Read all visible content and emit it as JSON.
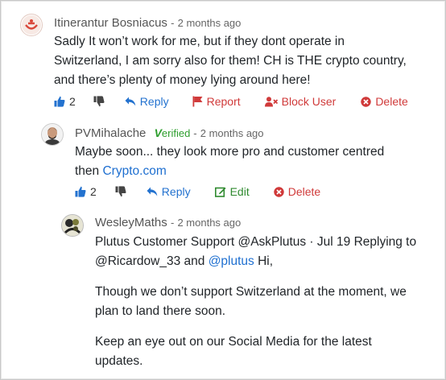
{
  "comments": [
    {
      "author": "Itinerantur Bosniacus",
      "separator": "-",
      "time": "2 months ago",
      "body": [
        "Sadly It won’t work for me, but if they dont operate in",
        "Switzerland, I am sorry also for them! CH is THE crypto country,",
        "and there’s plenty of money lying around here!"
      ],
      "likes": "2",
      "actions": {
        "reply": "Reply",
        "report": "Report",
        "block": "Block User",
        "delete": "Delete"
      }
    },
    {
      "author": "PVMihalache",
      "badge_prefix": "V",
      "badge_rest": "erified",
      "separator": "-",
      "time": "2 months ago",
      "body_line1": "Maybe soon... they look more pro and customer centred",
      "body_line2_prefix": "then ",
      "body_link": "Crypto.com",
      "likes": "2",
      "actions": {
        "reply": "Reply",
        "edit": "Edit",
        "delete": "Delete"
      }
    },
    {
      "author": "WesleyMaths",
      "separator": "-",
      "time": "2 months ago",
      "line1": "Plutus Customer Support @AskPlutus · Jul 19 Replying to",
      "line2_prefix": "@Ricardow_33 and ",
      "line2_link": "@plutus",
      "line2_suffix": " Hi,",
      "para2": [
        "Though we don’t support Switzerland at the moment, we",
        "plan to land there soon."
      ],
      "para3": [
        "Keep an eye out on our Social Media for the latest",
        "updates."
      ]
    }
  ],
  "colors": {
    "link": "#1e6fd0",
    "red": "#d03a3a",
    "green": "#2f8a2f",
    "verified": "#2e9e2e"
  },
  "icons": [
    "thumbs-up-icon",
    "thumbs-down-icon",
    "reply-icon",
    "flag-icon",
    "block-user-icon",
    "delete-icon",
    "edit-icon"
  ]
}
